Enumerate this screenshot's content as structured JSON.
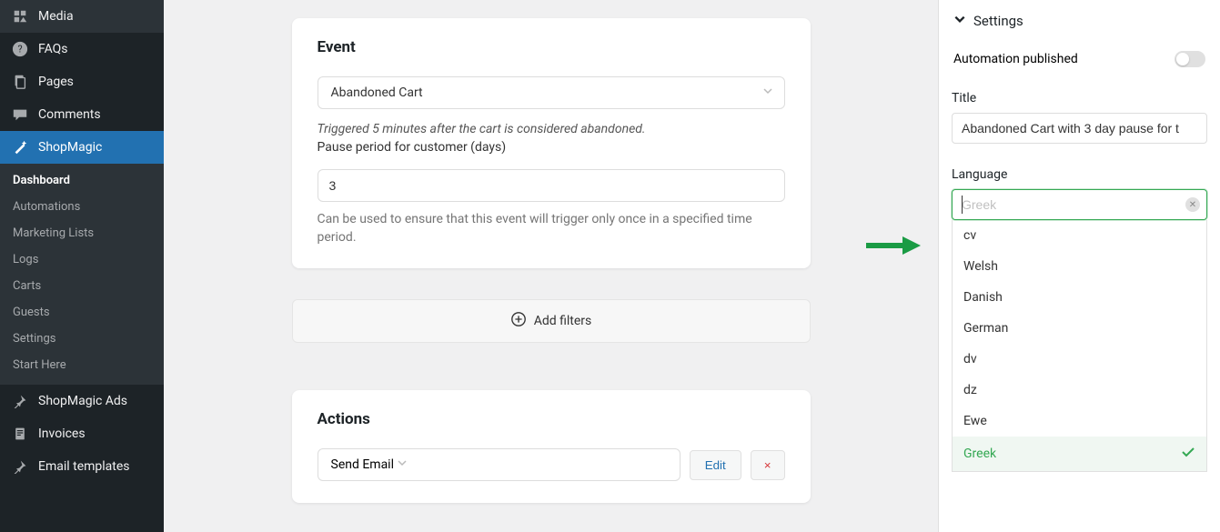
{
  "sidebar": {
    "items": [
      {
        "icon": "media",
        "label": "Media"
      },
      {
        "icon": "help",
        "label": "FAQs"
      },
      {
        "icon": "pages",
        "label": "Pages"
      },
      {
        "icon": "comments",
        "label": "Comments"
      },
      {
        "icon": "wand",
        "label": "ShopMagic",
        "active": true
      }
    ],
    "sub": [
      "Dashboard",
      "Automations",
      "Marketing Lists",
      "Logs",
      "Carts",
      "Guests",
      "Settings",
      "Start Here"
    ],
    "tail": [
      {
        "icon": "pin",
        "label": "ShopMagic Ads"
      },
      {
        "icon": "invoice",
        "label": "Invoices"
      },
      {
        "icon": "pin",
        "label": "Email templates"
      }
    ]
  },
  "event": {
    "title": "Event",
    "select_value": "Abandoned Cart",
    "trigger_note": "Triggered 5 minutes after the cart is considered abandoned.",
    "pause_label": "Pause period for customer (days)",
    "pause_value": "3",
    "pause_hint": "Can be used to ensure that this event will trigger only once in a specified time period."
  },
  "filters": {
    "add_filters": "Add filters"
  },
  "actions": {
    "title": "Actions",
    "select_value": "Send Email",
    "edit": "Edit",
    "delete": "×"
  },
  "settings": {
    "header": "Settings",
    "publish_label": "Automation published",
    "title_label": "Title",
    "title_value": "Abandoned Cart with 3 day pause for t",
    "language_label": "Language",
    "language_placeholder_typed": "Greek",
    "options": [
      "cv",
      "Welsh",
      "Danish",
      "German",
      "dv",
      "dz",
      "Ewe",
      "Greek"
    ]
  }
}
